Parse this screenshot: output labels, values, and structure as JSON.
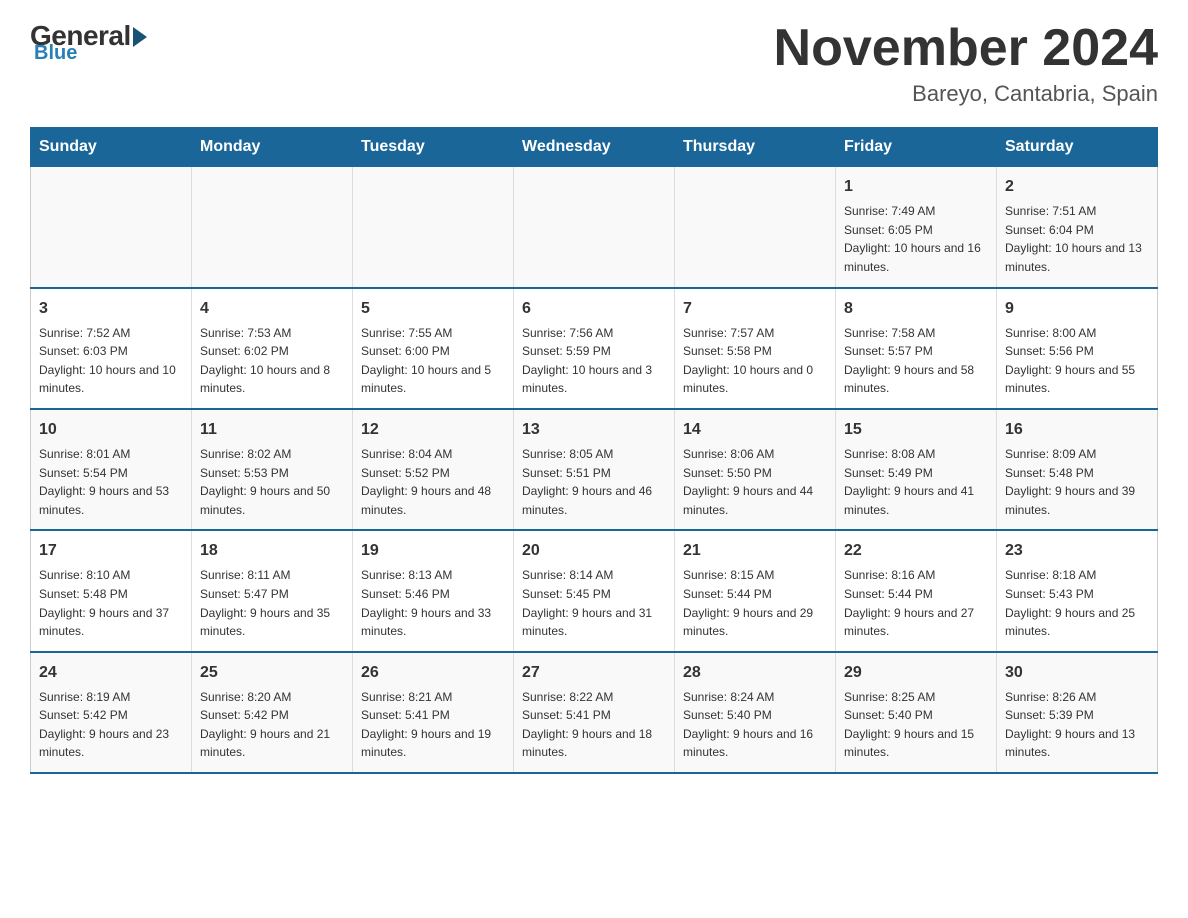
{
  "header": {
    "logo_general": "General",
    "logo_blue": "Blue",
    "month_title": "November 2024",
    "location": "Bareyo, Cantabria, Spain"
  },
  "days_of_week": [
    "Sunday",
    "Monday",
    "Tuesday",
    "Wednesday",
    "Thursday",
    "Friday",
    "Saturday"
  ],
  "weeks": [
    [
      {
        "day": "",
        "info": ""
      },
      {
        "day": "",
        "info": ""
      },
      {
        "day": "",
        "info": ""
      },
      {
        "day": "",
        "info": ""
      },
      {
        "day": "",
        "info": ""
      },
      {
        "day": "1",
        "info": "Sunrise: 7:49 AM\nSunset: 6:05 PM\nDaylight: 10 hours and 16 minutes."
      },
      {
        "day": "2",
        "info": "Sunrise: 7:51 AM\nSunset: 6:04 PM\nDaylight: 10 hours and 13 minutes."
      }
    ],
    [
      {
        "day": "3",
        "info": "Sunrise: 7:52 AM\nSunset: 6:03 PM\nDaylight: 10 hours and 10 minutes."
      },
      {
        "day": "4",
        "info": "Sunrise: 7:53 AM\nSunset: 6:02 PM\nDaylight: 10 hours and 8 minutes."
      },
      {
        "day": "5",
        "info": "Sunrise: 7:55 AM\nSunset: 6:00 PM\nDaylight: 10 hours and 5 minutes."
      },
      {
        "day": "6",
        "info": "Sunrise: 7:56 AM\nSunset: 5:59 PM\nDaylight: 10 hours and 3 minutes."
      },
      {
        "day": "7",
        "info": "Sunrise: 7:57 AM\nSunset: 5:58 PM\nDaylight: 10 hours and 0 minutes."
      },
      {
        "day": "8",
        "info": "Sunrise: 7:58 AM\nSunset: 5:57 PM\nDaylight: 9 hours and 58 minutes."
      },
      {
        "day": "9",
        "info": "Sunrise: 8:00 AM\nSunset: 5:56 PM\nDaylight: 9 hours and 55 minutes."
      }
    ],
    [
      {
        "day": "10",
        "info": "Sunrise: 8:01 AM\nSunset: 5:54 PM\nDaylight: 9 hours and 53 minutes."
      },
      {
        "day": "11",
        "info": "Sunrise: 8:02 AM\nSunset: 5:53 PM\nDaylight: 9 hours and 50 minutes."
      },
      {
        "day": "12",
        "info": "Sunrise: 8:04 AM\nSunset: 5:52 PM\nDaylight: 9 hours and 48 minutes."
      },
      {
        "day": "13",
        "info": "Sunrise: 8:05 AM\nSunset: 5:51 PM\nDaylight: 9 hours and 46 minutes."
      },
      {
        "day": "14",
        "info": "Sunrise: 8:06 AM\nSunset: 5:50 PM\nDaylight: 9 hours and 44 minutes."
      },
      {
        "day": "15",
        "info": "Sunrise: 8:08 AM\nSunset: 5:49 PM\nDaylight: 9 hours and 41 minutes."
      },
      {
        "day": "16",
        "info": "Sunrise: 8:09 AM\nSunset: 5:48 PM\nDaylight: 9 hours and 39 minutes."
      }
    ],
    [
      {
        "day": "17",
        "info": "Sunrise: 8:10 AM\nSunset: 5:48 PM\nDaylight: 9 hours and 37 minutes."
      },
      {
        "day": "18",
        "info": "Sunrise: 8:11 AM\nSunset: 5:47 PM\nDaylight: 9 hours and 35 minutes."
      },
      {
        "day": "19",
        "info": "Sunrise: 8:13 AM\nSunset: 5:46 PM\nDaylight: 9 hours and 33 minutes."
      },
      {
        "day": "20",
        "info": "Sunrise: 8:14 AM\nSunset: 5:45 PM\nDaylight: 9 hours and 31 minutes."
      },
      {
        "day": "21",
        "info": "Sunrise: 8:15 AM\nSunset: 5:44 PM\nDaylight: 9 hours and 29 minutes."
      },
      {
        "day": "22",
        "info": "Sunrise: 8:16 AM\nSunset: 5:44 PM\nDaylight: 9 hours and 27 minutes."
      },
      {
        "day": "23",
        "info": "Sunrise: 8:18 AM\nSunset: 5:43 PM\nDaylight: 9 hours and 25 minutes."
      }
    ],
    [
      {
        "day": "24",
        "info": "Sunrise: 8:19 AM\nSunset: 5:42 PM\nDaylight: 9 hours and 23 minutes."
      },
      {
        "day": "25",
        "info": "Sunrise: 8:20 AM\nSunset: 5:42 PM\nDaylight: 9 hours and 21 minutes."
      },
      {
        "day": "26",
        "info": "Sunrise: 8:21 AM\nSunset: 5:41 PM\nDaylight: 9 hours and 19 minutes."
      },
      {
        "day": "27",
        "info": "Sunrise: 8:22 AM\nSunset: 5:41 PM\nDaylight: 9 hours and 18 minutes."
      },
      {
        "day": "28",
        "info": "Sunrise: 8:24 AM\nSunset: 5:40 PM\nDaylight: 9 hours and 16 minutes."
      },
      {
        "day": "29",
        "info": "Sunrise: 8:25 AM\nSunset: 5:40 PM\nDaylight: 9 hours and 15 minutes."
      },
      {
        "day": "30",
        "info": "Sunrise: 8:26 AM\nSunset: 5:39 PM\nDaylight: 9 hours and 13 minutes."
      }
    ]
  ]
}
